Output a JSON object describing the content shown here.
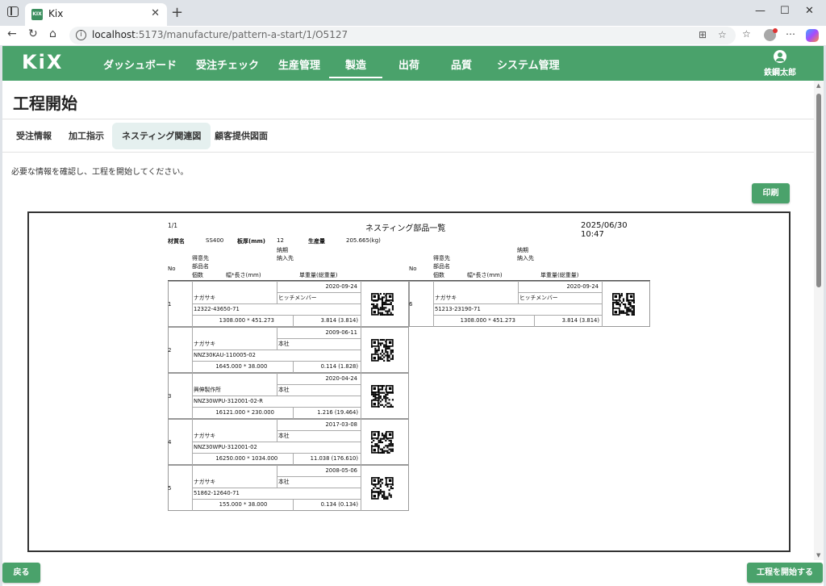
{
  "browser": {
    "tab_title": "Kix",
    "favicon_text": "KIX",
    "url_host": "localhost",
    "url_path": ":5173/manufacture/pattern-a-start/1/O5127"
  },
  "app": {
    "logo": "KiX",
    "nav": [
      {
        "label": "ダッシュボード"
      },
      {
        "label": "受注チェック"
      },
      {
        "label": "生産管理"
      },
      {
        "label": "製造",
        "active": true
      },
      {
        "label": "出荷"
      },
      {
        "label": "品質"
      },
      {
        "label": "システム管理"
      }
    ],
    "user_name": "鉄鋼太郎"
  },
  "page": {
    "title": "工程開始",
    "tabs": [
      {
        "label": "受注情報"
      },
      {
        "label": "加工指示"
      },
      {
        "label": "ネスティング関連図",
        "active": true
      },
      {
        "label": "顧客提供図面"
      }
    ],
    "message": "必要な情報を確認し、工程を開始してください。",
    "print_label": "印刷",
    "back_label": "戻る",
    "start_label": "工程を開始する"
  },
  "sheet": {
    "page_no": "1/1",
    "title": "ネスティング部品一覧",
    "datetime": "2025/06/30 10:47",
    "material_label": "材質名",
    "material_value": "SS400",
    "thickness_label": "板厚(mm)",
    "thickness_value": "12",
    "production_label": "生産量",
    "production_value": "205.665(kg)",
    "header": {
      "due": "納期",
      "destination": "納入先",
      "no": "No",
      "customer": "得意先",
      "part": "部品名",
      "qty": "個数",
      "size": "幅*長さ(mm)",
      "weight": "単重量(総重量)"
    },
    "items": [
      {
        "no": "1",
        "due": "2020-09-24",
        "customer": "ナガサキ",
        "dest": "ヒッチメンバー",
        "part": "12322-43650-71",
        "qty": "1",
        "size": "308.000 * 451.273",
        "weight": "3.814 (3.814)"
      },
      {
        "no": "2",
        "due": "2009-06-11",
        "customer": "ナガサキ",
        "dest": "本社",
        "part": "NNZ30KAU-110005-02",
        "qty": "16",
        "size": "45.000 * 38.000",
        "weight": "0.114 (1.828)"
      },
      {
        "no": "3",
        "due": "2020-04-24",
        "customer": "興伸製作所",
        "dest": "本社",
        "part": "NNZ30WPU-312001-02-R",
        "qty": "16",
        "size": "121.000 * 230.000",
        "weight": "1.216 (19.464)"
      },
      {
        "no": "4",
        "due": "2017-03-08",
        "customer": "ナガサキ",
        "dest": "本社",
        "part": "NNZ30WPU-312001-02",
        "qty": "16",
        "size": "250.000 * 1034.000",
        "weight": "11.038 (176.610)"
      },
      {
        "no": "5",
        "due": "2008-05-06",
        "customer": "ナガサキ",
        "dest": "本社",
        "part": "51862-12640-71",
        "qty": "1",
        "size": "55.000 * 38.000",
        "weight": "0.134 (0.134)"
      },
      {
        "no": "6",
        "due": "2020-09-24",
        "customer": "ナガサキ",
        "dest": "ヒッチメンバー",
        "part": "51213-23190-71",
        "qty": "1",
        "size": "308.000 * 451.273",
        "weight": "3.814 (3.814)"
      }
    ]
  },
  "colors": {
    "brand": "#4aa26b",
    "active_tab_bg": "#e5f0ef"
  },
  "icons": {
    "qr": "qr-code-icon",
    "user": "user-icon"
  }
}
